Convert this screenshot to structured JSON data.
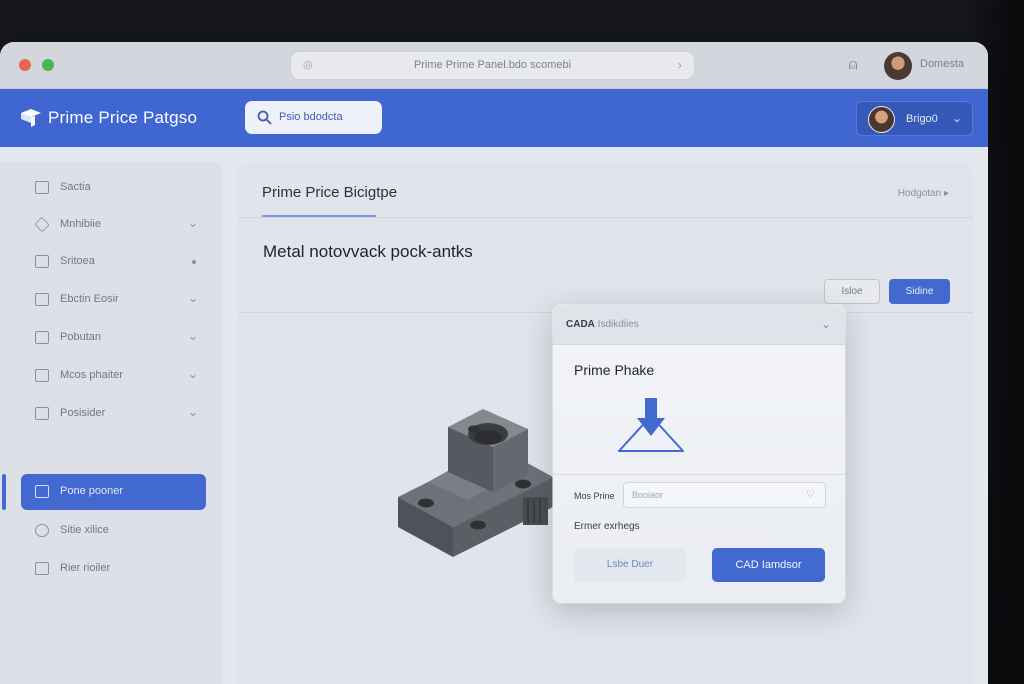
{
  "browser": {
    "url": "Prime Prime Panel.bdo scomebi",
    "user": "Domesta"
  },
  "appbar": {
    "brand": "Prime Price Patgso",
    "search_placeholder": "Psio bdodcta",
    "account_name": "Brigo0"
  },
  "sidebar": {
    "items": [
      {
        "label": "Sactia",
        "icon": "home-icon",
        "trail": "none"
      },
      {
        "label": "Mnhibiie",
        "icon": "tag-icon",
        "trail": "chevron"
      },
      {
        "label": "Sritoea",
        "icon": "grid-icon",
        "trail": "dot"
      },
      {
        "label": "Ebctin Eosir",
        "icon": "card-icon",
        "trail": "chevron"
      },
      {
        "label": "Pobutan",
        "icon": "list-icon",
        "trail": "chevron"
      },
      {
        "label": "Mcos phaiter",
        "icon": "calendar-icon",
        "trail": "chevron"
      },
      {
        "label": "Posisider",
        "icon": "box-icon",
        "trail": "chevron"
      },
      {
        "label": "Pone pooner",
        "icon": "layer-icon",
        "trail": "none",
        "active": true
      },
      {
        "label": "Sitie xilice",
        "icon": "circle-icon",
        "trail": "none"
      },
      {
        "label": "Rier rioiler",
        "icon": "file-icon",
        "trail": "none"
      }
    ]
  },
  "main": {
    "heading": "Prime Price Bicigtpe",
    "top_link": "Hodgotan",
    "product_title": "Metal notovvack pock-antks",
    "secondary_btn": "Isloe",
    "primary_btn": "Sidine"
  },
  "dialog": {
    "header_bold": "CADA",
    "header_light": "Isdikdiies",
    "title": "Prime Phake",
    "field_label": "Mos Prine",
    "field_placeholder": "Booiaor",
    "hint": "Ermer exrhegs",
    "cancel_btn": "Lsbe Duer",
    "submit_btn": "CAD Iamdsor"
  },
  "colors": {
    "accent": "#4169cf",
    "appbar": "#3f66d1"
  }
}
